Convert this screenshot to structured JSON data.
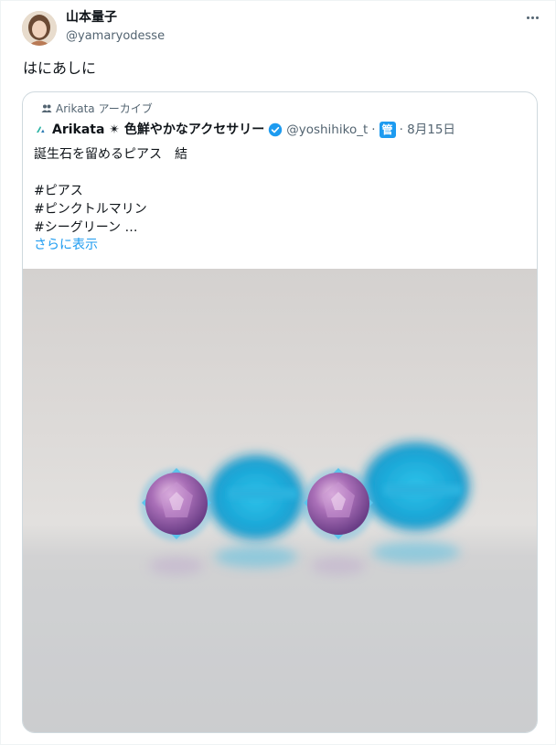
{
  "author": {
    "name": "山本量子",
    "handle": "@yamaryodesse",
    "avatar_icon": "avatar-photo"
  },
  "tweet": {
    "text": "はにあしに"
  },
  "quote": {
    "social_context": "Arikata アーカイブ",
    "author_name": "Arikata ✴ 色鮮やかなアクセサリー",
    "handle": "@yoshihiko_t",
    "sep": "·",
    "badge": "管",
    "date": "· 8月15日",
    "body": "誕生石を留めるピアス　結\n\n#ピアス\n#ピンクトルマリン\n#シーグリーン …",
    "show_more": "さらに表示",
    "image_icon": "earrings-photo"
  },
  "colors": {
    "accent": "#1d9bf0",
    "secondary_text": "#536471",
    "border": "#cfd9de"
  }
}
